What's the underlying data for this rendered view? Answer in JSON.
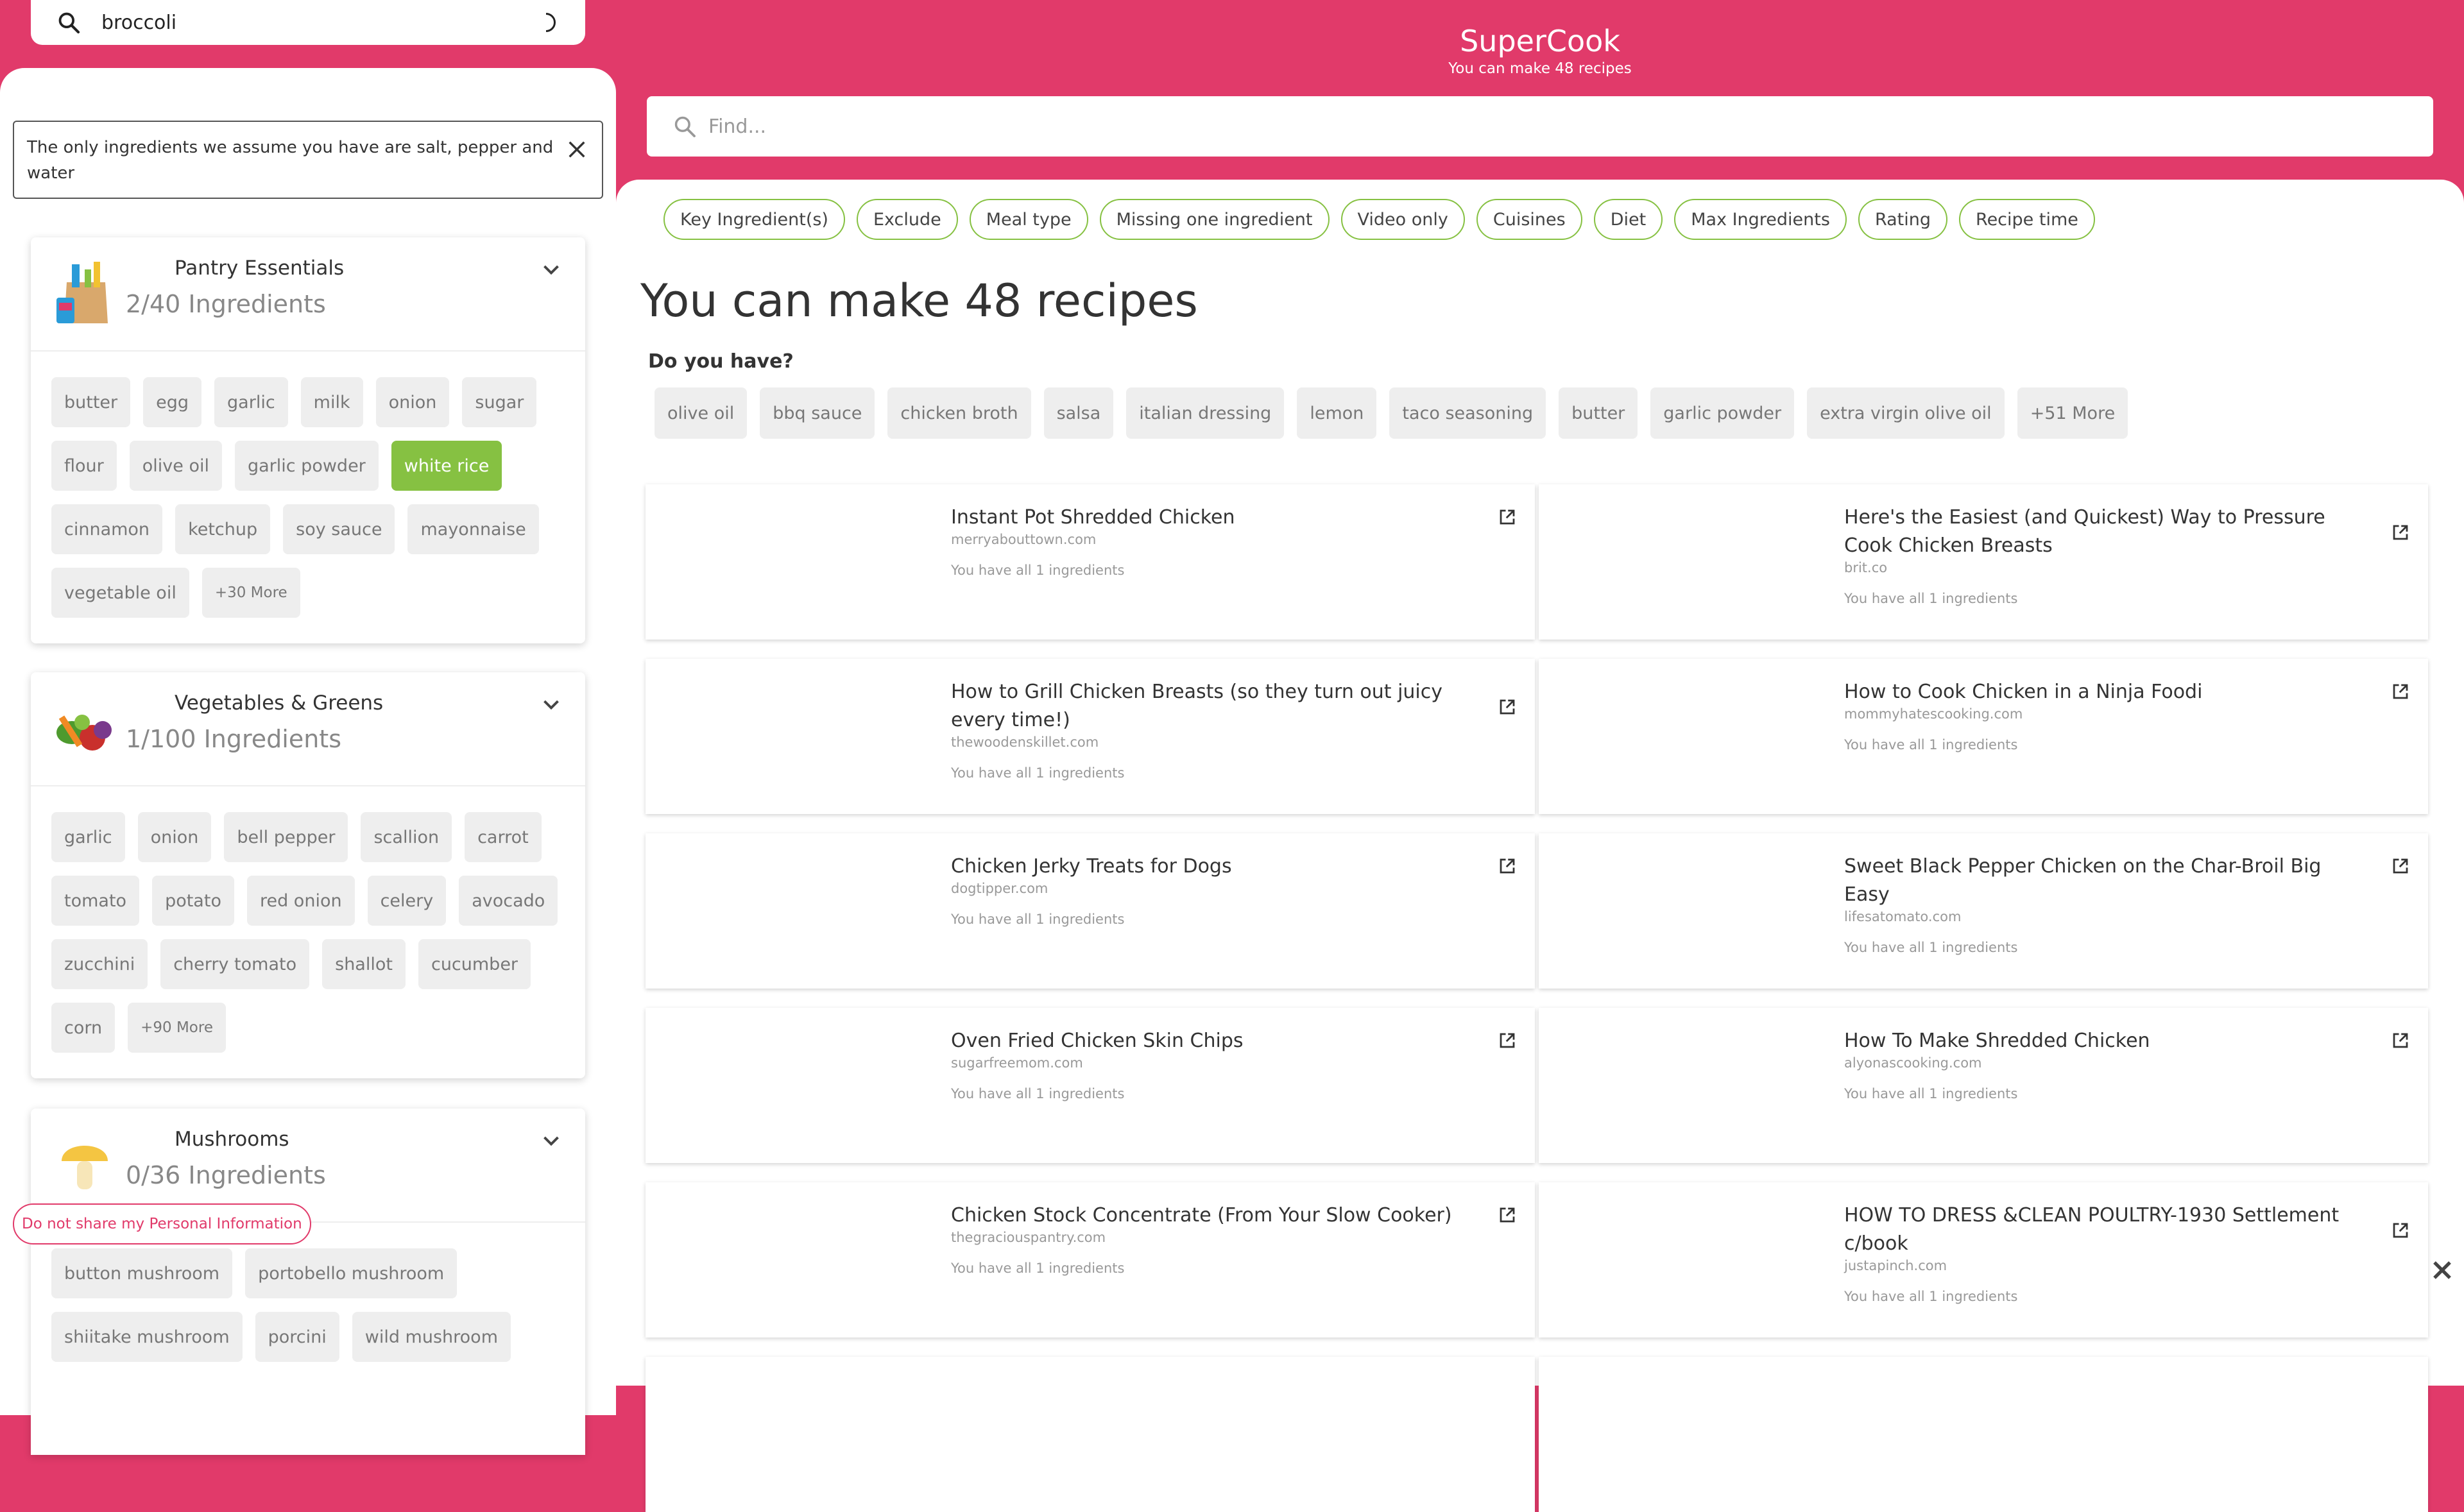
{
  "search": {
    "value": "broccoli"
  },
  "notice": {
    "text": "The only ingredients we assume you have are salt, pepper and water"
  },
  "categories": [
    {
      "title": "Pantry Essentials",
      "count": "2/40 Ingredients",
      "chips": [
        "butter",
        "egg",
        "garlic",
        "milk",
        "onion",
        "sugar",
        "flour",
        "olive oil",
        "garlic powder",
        "white rice",
        "cinnamon",
        "ketchup",
        "soy sauce",
        "mayonnaise",
        "vegetable oil"
      ],
      "more": "+30 More"
    },
    {
      "title": "Vegetables & Greens",
      "count": "1/100 Ingredients",
      "chips": [
        "garlic",
        "onion",
        "bell pepper",
        "scallion",
        "carrot",
        "tomato",
        "potato",
        "red onion",
        "celery",
        "avocado",
        "zucchini",
        "cherry tomato",
        "shallot",
        "cucumber",
        "corn"
      ],
      "more": "+90 More"
    },
    {
      "title": "Mushrooms",
      "count": "0/36 Ingredients",
      "chips": [
        "button mushroom",
        "portobello mushroom",
        "shiitake mushroom",
        "porcini",
        "wild mushroom"
      ]
    }
  ],
  "privacy": {
    "label": "Do not share my Personal Information"
  },
  "brand": {
    "name": "SuperCook",
    "subtitle": "You can make 48 recipes"
  },
  "find": {
    "placeholder": "Find..."
  },
  "filters": [
    "Key Ingredient(s)",
    "Exclude",
    "Meal type",
    "Missing one ingredient",
    "Video only",
    "Cuisines",
    "Diet",
    "Max Ingredients",
    "Rating",
    "Recipe time"
  ],
  "headline": "You can make 48 recipes",
  "do_you_have": {
    "label": "Do you have?",
    "items": [
      "olive oil",
      "bbq sauce",
      "chicken broth",
      "salsa",
      "italian dressing",
      "lemon",
      "taco seasoning",
      "butter",
      "garlic powder",
      "extra virgin olive oil",
      "+51 More"
    ]
  },
  "recipes": [
    {
      "title": "Instant Pot Shredded Chicken",
      "source": "merryabouttown.com",
      "have": "You have all 1 ingredients"
    },
    {
      "title": "Here's the Easiest (and Quickest) Way to Pressure Cook Chicken Breasts",
      "source": "brit.co",
      "have": "You have all 1 ingredients"
    },
    {
      "title": "How to Grill Chicken Breasts (so they turn out juicy every time!)",
      "source": "thewoodenskillet.com",
      "have": "You have all 1 ingredients"
    },
    {
      "title": "How to Cook Chicken in a Ninja Foodi",
      "source": "mommyhatescooking.com",
      "have": "You have all 1 ingredients"
    },
    {
      "title": "Chicken Jerky Treats for Dogs",
      "source": "dogtipper.com",
      "have": "You have all 1 ingredients"
    },
    {
      "title": "Sweet Black Pepper Chicken on the Char-Broil Big Easy",
      "source": "lifesatomato.com",
      "have": "You have all 1 ingredients"
    },
    {
      "title": "Oven Fried Chicken Skin Chips",
      "source": "sugarfreemom.com",
      "have": "You have all 1 ingredients"
    },
    {
      "title": "How To Make Shredded Chicken",
      "source": "alyonascooking.com",
      "have": "You have all 1 ingredients"
    },
    {
      "title": "Chicken Stock Concentrate (From Your Slow Cooker)",
      "source": "thegraciouspantry.com",
      "have": "You have all 1 ingredients"
    },
    {
      "title": "HOW TO DRESS &CLEAN POULTRY-1930 Settlement c/book",
      "source": "justapinch.com",
      "have": "You have all 1 ingredients"
    }
  ],
  "colors": {
    "brand": "#e13a6a",
    "accent": "#86c142",
    "chip": "#eeeeee"
  },
  "icons": [
    "search-icon",
    "spinner-icon",
    "close-icon",
    "chevron-down-icon",
    "external-link-icon"
  ]
}
